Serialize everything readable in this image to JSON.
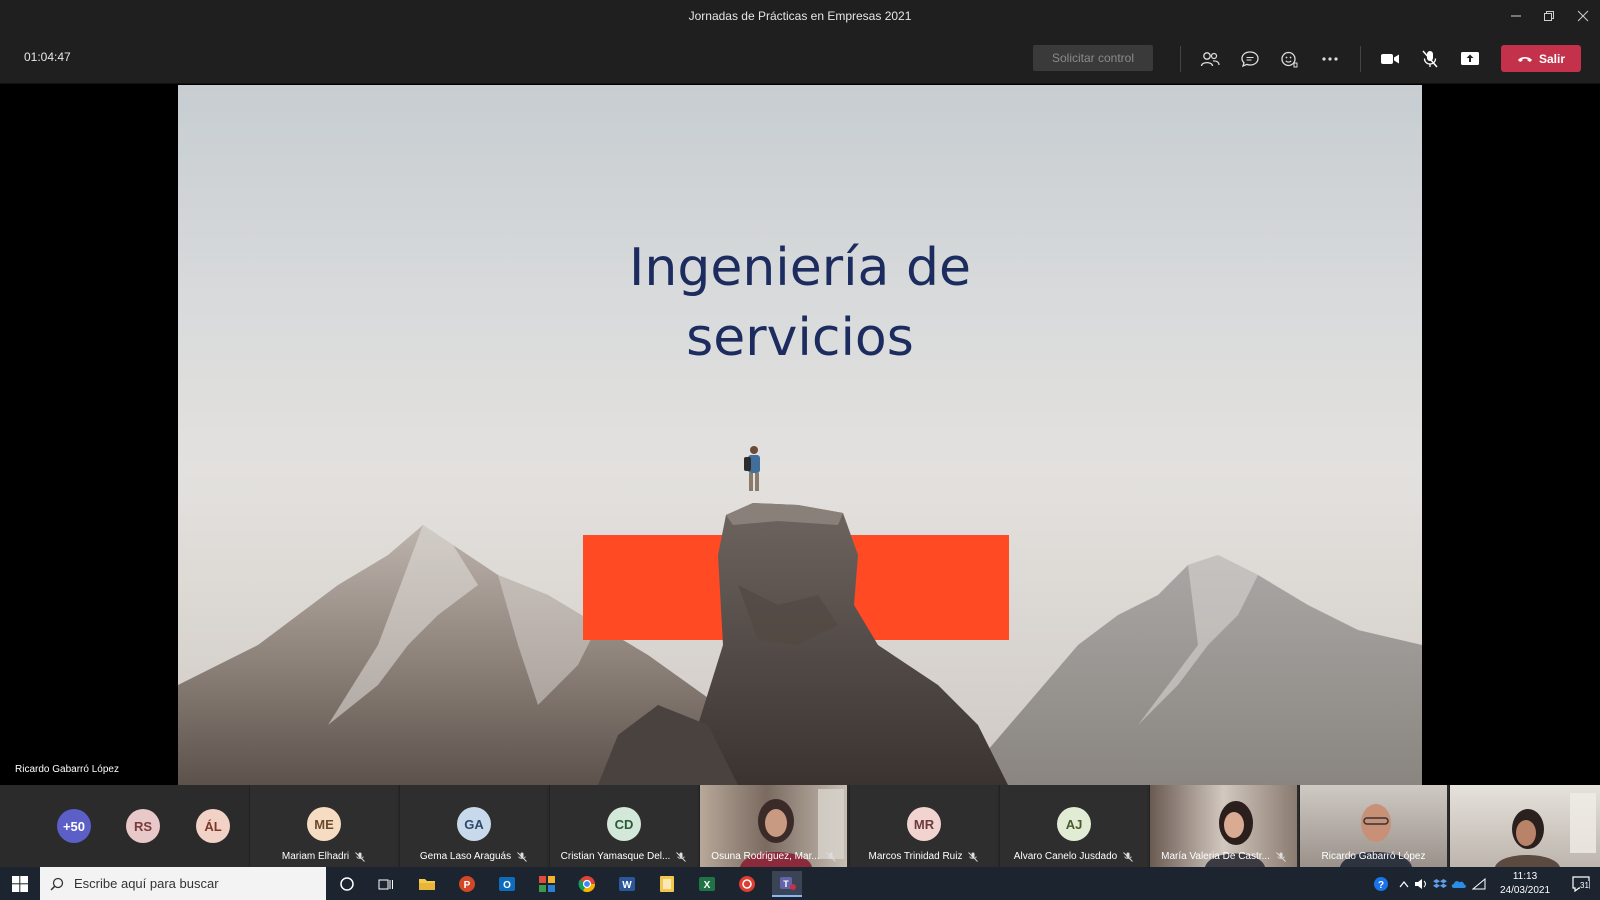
{
  "window": {
    "title": "Jornadas de Prácticas en Empresas 2021",
    "controls": [
      "minimize-icon",
      "restore-icon",
      "close-icon"
    ]
  },
  "toolbar": {
    "timer": "01:04:47",
    "request_control_label": "Solicitar control",
    "leave_label": "Salir",
    "icons": [
      "participants-icon",
      "chat-icon",
      "reactions-icon",
      "more-icon",
      "camera-icon",
      "mic-off-icon",
      "share-icon"
    ],
    "leave_color": "#c4314b"
  },
  "slide": {
    "title_line1": "Ingeniería de",
    "title_line2": "servicios",
    "title_color": "#1d2c5f",
    "accent_color": "#ff4a24"
  },
  "presenter": {
    "name": "Ricardo Gabarró López"
  },
  "participants": {
    "overflow": "+50",
    "bubbles": [
      {
        "initials": "RS",
        "bg": "#e8c8c8",
        "fg": "#7a3a3a"
      },
      {
        "initials": "ÁL",
        "bg": "#f2d2c6",
        "fg": "#7a3a2a"
      }
    ],
    "tiles": [
      {
        "initials": "ME",
        "name": "Mariam Elhadri",
        "bg": "#f5dcc3",
        "fg": "#6b4a2a",
        "video": false
      },
      {
        "initials": "GA",
        "name": "Gema Laso Araguás",
        "bg": "#c9d9ec",
        "fg": "#2d4a6b",
        "video": false
      },
      {
        "initials": "CD",
        "name": "Cristian Yamasque Del...",
        "bg": "#d3e8d8",
        "fg": "#2a5a3a",
        "video": false
      },
      {
        "initials": "",
        "name": "Osuna Rodriguez, Mar...",
        "bg": "",
        "fg": "",
        "video": true
      },
      {
        "initials": "MR",
        "name": "Marcos Trinidad Ruiz",
        "bg": "#f1d4cf",
        "fg": "#6b3a3a",
        "video": false
      },
      {
        "initials": "AJ",
        "name": "Alvaro Canelo Jusdado",
        "bg": "#e2ecd5",
        "fg": "#4a5a2a",
        "video": false
      },
      {
        "initials": "",
        "name": "María Valeria De Castr...",
        "bg": "",
        "fg": "",
        "video": true
      },
      {
        "initials": "",
        "name": "Ricardo Gabarró López",
        "bg": "",
        "fg": "",
        "video": true
      },
      {
        "initials": "",
        "name": "",
        "bg": "",
        "fg": "",
        "video": true
      }
    ]
  },
  "taskbar": {
    "search_placeholder": "Escribe aquí para buscar",
    "time": "11:13",
    "date": "24/03/2021",
    "notification_count": "31"
  }
}
